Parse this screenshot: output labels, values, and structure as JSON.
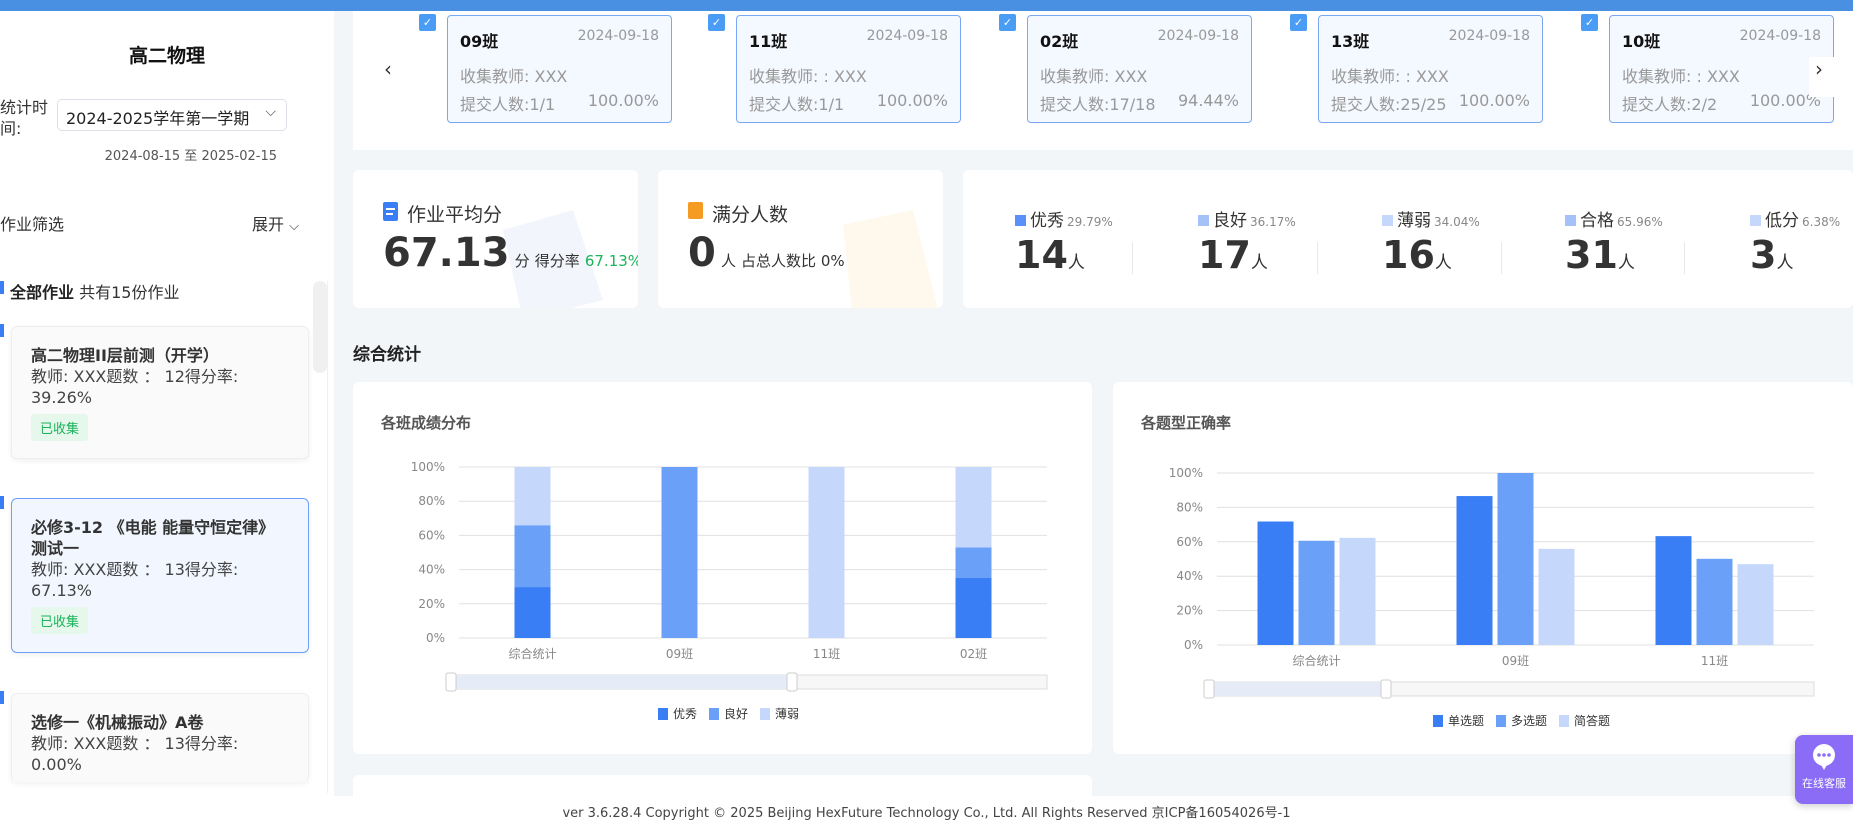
{
  "sidebar": {
    "title": "高二物理",
    "period_label": "统计时间:",
    "period_value": "2024-2025学年第一学期",
    "date_range": "2024-08-15 至 2025-02-15",
    "filter_label": "作业筛选",
    "expand_label": "展开",
    "all_label": "全部作业",
    "all_count": "共有15份作业",
    "homeworks": [
      {
        "title": "高二物理II层前测（开学）",
        "line1": "教师:  XXX题数 ： 12得分率:",
        "line2": "39.26%",
        "badge": "已收集"
      },
      {
        "title": "必修3-12 《电能 能量守恒定律》测试一",
        "line1": "教师:  XXX题数 ： 13得分率:",
        "line2": "67.13%",
        "badge": "已收集"
      },
      {
        "title": "选修一《机械振动》A卷",
        "line1": "教师:  XXX题数 ： 13得分率:",
        "line2": "0.00%"
      }
    ]
  },
  "classes": [
    {
      "name": "09班",
      "date": "2024-09-18",
      "teacher": "收集教师:  XXX",
      "submit": "提交人数:1/1",
      "pct": "100.00%"
    },
    {
      "name": "11班",
      "date": "2024-09-18",
      "teacher": "收集教师: : XXX",
      "submit": "提交人数:1/1",
      "pct": "100.00%"
    },
    {
      "name": "02班",
      "date": "2024-09-18",
      "teacher": "收集教师:  XXX",
      "submit": "提交人数:17/18",
      "pct": "94.44%"
    },
    {
      "name": "13班",
      "date": "2024-09-18",
      "teacher": "收集教师: : XXX",
      "submit": "提交人数:25/25",
      "pct": "100.00%"
    },
    {
      "name": "10班",
      "date": "2024-09-18",
      "teacher": "收集教师: : XXX",
      "submit": "提交人数:2/2",
      "pct": "100.00%"
    }
  ],
  "stats": {
    "avg_title": "作业平均分",
    "avg_value": "67.13",
    "avg_unit": "分",
    "avg_rate_label": "得分率",
    "avg_rate": "67.13%",
    "full_title": "满分人数",
    "full_value": "0",
    "full_unit": "人",
    "full_ratio": "占总人数比 0%",
    "grades": [
      {
        "label": "优秀",
        "pct": "29.79%",
        "count": "14",
        "unit": "人",
        "color": "#5b8ff9"
      },
      {
        "label": "良好",
        "pct": "36.17%",
        "count": "17",
        "unit": "人",
        "color": "#a4c2f8"
      },
      {
        "label": "薄弱",
        "pct": "34.04%",
        "count": "16",
        "unit": "人",
        "color": "#c5d8fc"
      },
      {
        "label": "合格",
        "pct": "65.96%",
        "count": "31",
        "unit": "人",
        "color": "#a4c2f8"
      },
      {
        "label": "低分",
        "pct": "6.38%",
        "count": "3",
        "unit": "人",
        "color": "#c5d8fc"
      }
    ]
  },
  "section_title": "综合统计",
  "chart_data": [
    {
      "type": "bar",
      "stacked": true,
      "title": "各班成绩分布",
      "categories": [
        "综合统计",
        "09班",
        "11班",
        "02班"
      ],
      "ylim": [
        0,
        100
      ],
      "yticks": [
        "0%",
        "20%",
        "40%",
        "60%",
        "80%",
        "100%"
      ],
      "legend": "bottom",
      "series": [
        {
          "name": "优秀",
          "color": "#3a7ef5",
          "values": [
            29.79,
            0,
            0,
            35.29
          ]
        },
        {
          "name": "良好",
          "color": "#6aa0f7",
          "values": [
            36.17,
            100,
            0,
            17.65
          ]
        },
        {
          "name": "薄弱",
          "color": "#c5d8fc",
          "values": [
            34.04,
            0,
            100,
            47.06
          ]
        }
      ]
    },
    {
      "type": "bar",
      "stacked": false,
      "title": "各题型正确率",
      "categories": [
        "综合统计",
        "09班",
        "11班"
      ],
      "ylim": [
        0,
        100
      ],
      "yticks": [
        "0%",
        "20%",
        "40%",
        "60%",
        "80%",
        "100%"
      ],
      "legend": "bottom",
      "series": [
        {
          "name": "单选题",
          "color": "#3a7ef5",
          "values": [
            71.8,
            86.6,
            63.3
          ]
        },
        {
          "name": "多选题",
          "color": "#6aa0f7",
          "values": [
            60.6,
            100,
            50.1
          ]
        },
        {
          "name": "简答题",
          "color": "#c5d8fc",
          "values": [
            62.3,
            55.9,
            47
          ]
        }
      ]
    }
  ],
  "footer": "ver 3.6.28.4 Copyright © 2025 Beijing HexFuture Technology Co., Ltd. All Rights Reserved 京ICP备16054026号-1",
  "chat_label": "在线客服"
}
